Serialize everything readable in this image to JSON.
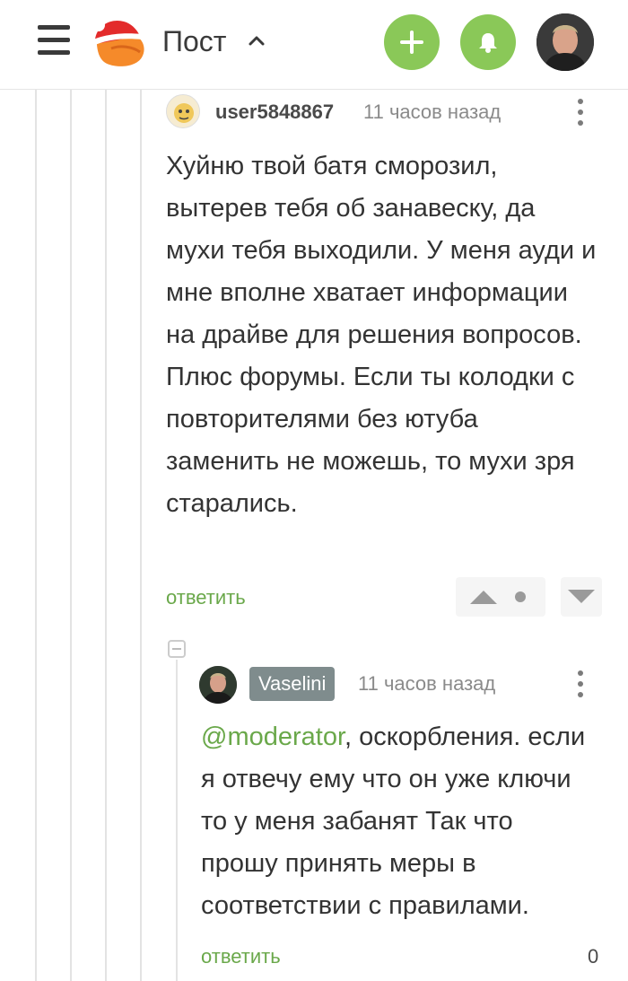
{
  "header": {
    "title": "Пост"
  },
  "comments": [
    {
      "username": "user5848867",
      "time": "11 часов назад",
      "text": "Хуйню твой батя сморозил, вытерев тебя об занавеску, да мухи тебя выходили. У меня ауди и мне вполне хватает информации на драйве для решения вопросов. Плюс форумы. Если ты колодки с повторителями без ютуба заменить не можешь, то мухи зря старались.",
      "reply_label": "ответить"
    },
    {
      "username": "Vaselini",
      "time": "11 часов назад",
      "mention": "@moderator",
      "text": ", оскорбления. если я отвечу ему что он уже ключи то у меня забанят Так что прошу принять меры в соответствии с правилами.",
      "reply_label": "ответить",
      "score": "0"
    }
  ],
  "colors": {
    "accent_green": "#8ac858",
    "link_green": "#6aa84a",
    "badge_gray": "#7f8c8d"
  },
  "icons": [
    "menu-icon",
    "logo-icon",
    "chevron-up-icon",
    "plus-icon",
    "bell-icon",
    "more-vertical-icon",
    "arrow-up-icon",
    "arrow-down-icon",
    "collapse-icon"
  ]
}
